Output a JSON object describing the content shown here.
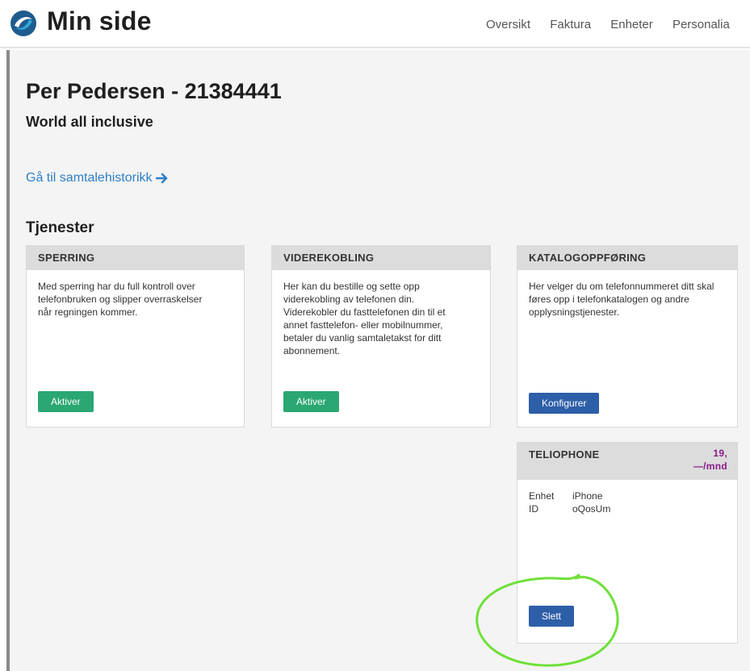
{
  "header": {
    "brand": "Min side",
    "nav": [
      "Oversikt",
      "Faktura",
      "Enheter",
      "Personalia"
    ]
  },
  "page": {
    "title": "Per Pedersen - 21384441",
    "subtitle": "World all inclusive",
    "history_link": "Gå til samtalehistorikk",
    "services_title": "Tjenester"
  },
  "cards": {
    "sperring": {
      "title": "SPERRING",
      "text": "Med sperring har du full kontroll over telefonbruken og slipper overraskelser når regningen kommer.",
      "button": "Aktiver"
    },
    "viderekobling": {
      "title": "VIDEREKOBLING",
      "text": "Her kan du bestille og sette opp viderekobling av telefonen din. Viderekobler du fasttelefonen din til et annet fasttelefon- eller mobilnummer, betaler du vanlig samtaletakst for ditt abonnement.",
      "button": "Aktiver"
    },
    "katalog": {
      "title": "KATALOGOPPFØRING",
      "text": "Her velger du om telefonnummeret ditt skal føres opp i telefonkatalogen og andre opplysningstjenester.",
      "button": "Konfigurer"
    },
    "teliophone": {
      "title": "TELIOPHONE",
      "price_line1": "19,",
      "price_line2": "—/mnd",
      "device_label": "Enhet",
      "device_value": "iPhone",
      "id_label": "ID",
      "id_value": "oQosUm",
      "button": "Slett"
    }
  },
  "colors": {
    "accent_green": "#2aa772",
    "accent_blue": "#2d5ea8",
    "link": "#2f7fc4",
    "price": "#8a1a8a",
    "annotation": "#6fe03a"
  }
}
